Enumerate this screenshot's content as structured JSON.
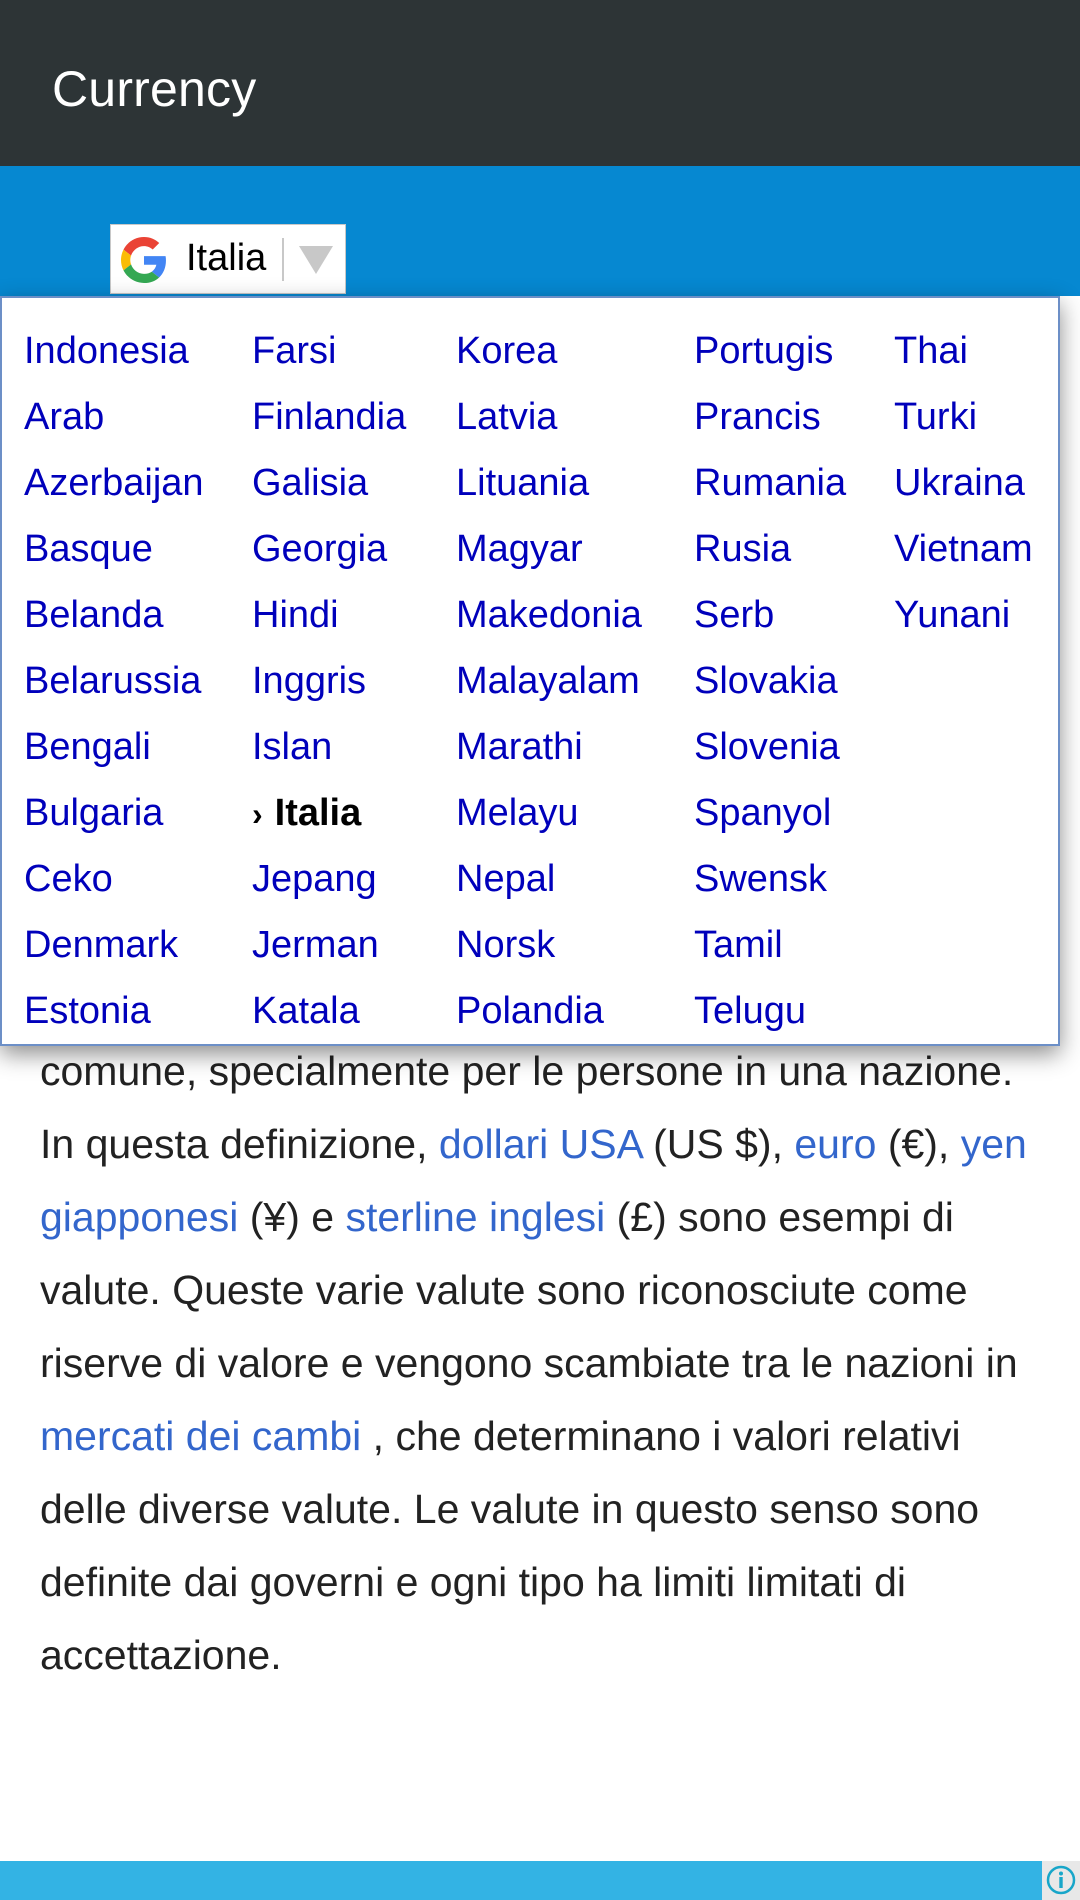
{
  "appbar": {
    "title": "Currency"
  },
  "translate": {
    "selected_language": "Italia",
    "menu_columns": [
      [
        "Indonesia",
        "Arab",
        "Azerbaijan",
        "Basque",
        "Belanda",
        "Belarussia",
        "Bengali",
        "Bulgaria",
        "Ceko",
        "Denmark",
        "Estonia"
      ],
      [
        "Farsi",
        "Finlandia",
        "Galisia",
        "Georgia",
        "Hindi",
        "Inggris",
        "Islan",
        "Italia",
        "Jepang",
        "Jerman",
        "Katala"
      ],
      [
        "Korea",
        "Latvia",
        "Lituania",
        "Magyar",
        "Makedonia",
        "Malayalam",
        "Marathi",
        "Melayu",
        "Nepal",
        "Norsk",
        "Polandia"
      ],
      [
        "Portugis",
        "Prancis",
        "Rumania",
        "Rusia",
        "Serb",
        "Slovakia",
        "Slovenia",
        "Spanyol",
        "Swensk",
        "Tamil",
        "Telugu"
      ],
      [
        "Thai",
        "Turki",
        "Ukraina",
        "Vietnam",
        "Yunani"
      ]
    ],
    "selected_marker": "›"
  },
  "article": {
    "p1": "comune, specialmente per le persone in una nazione.  In questa definizione, ",
    "link_usd": "dollari USA",
    "t2": "  (US $),  ",
    "link_euro": "euro",
    "t3": "  (€),  ",
    "link_yen": "yen giapponesi",
    "t4": "  (¥) e  ",
    "link_gbp": "sterline inglesi",
    "t5": "  (£) sono esempi di valute. Queste varie valute sono riconosciute come riserve di valore e vengono scambiate tra le nazioni in ",
    "link_fx": "mercati dei cambi",
    "t6": " , che determinano i valori relativi delle diverse valute.  Le valute in questo senso sono definite dai governi e ogni tipo ha limiti limitati di accettazione."
  },
  "colors": {
    "appbar": "#2d3436",
    "band": "#0688d1",
    "link": "#3366cc",
    "menu_item": "#0000bb",
    "ad_bar": "#33b3e4"
  }
}
